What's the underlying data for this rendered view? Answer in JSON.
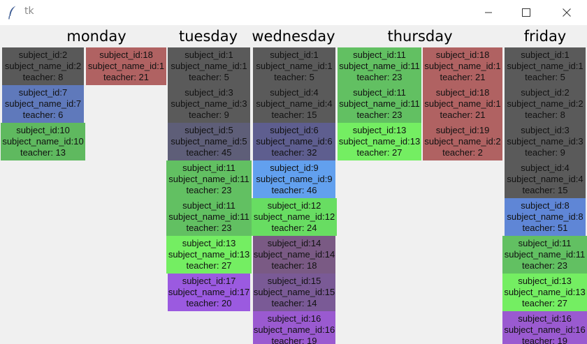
{
  "window": {
    "title": "tk",
    "icon": "feather-icon"
  },
  "days": [
    {
      "name": "monday",
      "columns": [
        [
          {
            "subject": "subject_id:2",
            "name": "subject_name_id:2",
            "teacher": "teacher: 8",
            "color": "#595959"
          },
          {
            "subject": "subject_id:7",
            "name": "subject_name_id:7",
            "teacher": "teacher: 6",
            "color": "#5f79bb"
          },
          {
            "subject": "subject_id:10",
            "name": "subject_name_id:10",
            "teacher": "teacher: 13",
            "color": "#5fb95f"
          }
        ],
        [
          {
            "subject": "subject_id:18",
            "name": "subject_name_id:1",
            "teacher": "teacher: 21",
            "color": "#b06262"
          }
        ]
      ]
    },
    {
      "name": "tuesday",
      "columns": [
        [
          {
            "subject": "subject_id:1",
            "name": "subject_name_id:1",
            "teacher": "teacher: 5",
            "color": "#5a5a5a"
          },
          {
            "subject": "subject_id:3",
            "name": "subject_name_id:3",
            "teacher": "teacher: 9",
            "color": "#5a5a5a"
          },
          {
            "subject": "subject_id:5",
            "name": "subject_name_id:5",
            "teacher": "teacher: 45",
            "color": "#5e5e78"
          },
          {
            "subject": "subject_id:11",
            "name": "subject_name_id:11",
            "teacher": "teacher: 23",
            "color": "#62c062"
          },
          {
            "subject": "subject_id:11",
            "name": "subject_name_id:11",
            "teacher": "teacher: 23",
            "color": "#62c062"
          },
          {
            "subject": "subject_id:13",
            "name": "subject_name_id:13",
            "teacher": "teacher: 27",
            "color": "#74ee62"
          },
          {
            "subject": "subject_id:17",
            "name": "subject_name_id:17",
            "teacher": "teacher: 20",
            "color": "#9b5ae0"
          }
        ]
      ]
    },
    {
      "name": "wednesday",
      "columns": [
        [
          {
            "subject": "subject_id:1",
            "name": "subject_name_id:1",
            "teacher": "teacher: 5",
            "color": "#5a5a5a"
          },
          {
            "subject": "subject_id:4",
            "name": "subject_name_id:4",
            "teacher": "teacher: 15",
            "color": "#5a5a5a"
          },
          {
            "subject": "subject_id:6",
            "name": "subject_name_id:6",
            "teacher": "teacher: 32",
            "color": "#5e5e8f"
          },
          {
            "subject": "subject_id:9",
            "name": "subject_name_id:9",
            "teacher": "teacher: 46",
            "color": "#62a0ee"
          },
          {
            "subject": "subject_id:12",
            "name": "subject_name_id:12",
            "teacher": "teacher: 24",
            "color": "#68dd62"
          },
          {
            "subject": "subject_id:14",
            "name": "subject_name_id:14",
            "teacher": "teacher: 18",
            "color": "#7a5a84"
          },
          {
            "subject": "subject_id:15",
            "name": "subject_name_id:15",
            "teacher": "teacher: 14",
            "color": "#7a5a96"
          },
          {
            "subject": "subject_id:16",
            "name": "subject_name_id:16",
            "teacher": "teacher: 19",
            "color": "#9a5ad0"
          }
        ]
      ]
    },
    {
      "name": "thursday",
      "columns": [
        [
          {
            "subject": "subject_id:11",
            "name": "subject_name_id:11",
            "teacher": "teacher: 23",
            "color": "#62c062"
          },
          {
            "subject": "subject_id:11",
            "name": "subject_name_id:11",
            "teacher": "teacher: 23",
            "color": "#62c062"
          },
          {
            "subject": "subject_id:13",
            "name": "subject_name_id:13",
            "teacher": "teacher: 27",
            "color": "#74ee62"
          }
        ],
        [
          {
            "subject": "subject_id:18",
            "name": "subject_name_id:1",
            "teacher": "teacher: 21",
            "color": "#b06262"
          },
          {
            "subject": "subject_id:18",
            "name": "subject_name_id:1",
            "teacher": "teacher: 21",
            "color": "#b06262"
          },
          {
            "subject": "subject_id:19",
            "name": "subject_name_id:2",
            "teacher": "teacher: 2",
            "color": "#b06262"
          }
        ]
      ]
    },
    {
      "name": "friday",
      "columns": [
        [
          {
            "subject": "subject_id:1",
            "name": "subject_name_id:1",
            "teacher": "teacher: 5",
            "color": "#5a5a5a"
          },
          {
            "subject": "subject_id:2",
            "name": "subject_name_id:2",
            "teacher": "teacher: 8",
            "color": "#5a5a5a"
          },
          {
            "subject": "subject_id:3",
            "name": "subject_name_id:3",
            "teacher": "teacher: 9",
            "color": "#5a5a5a"
          },
          {
            "subject": "subject_id:4",
            "name": "subject_name_id:4",
            "teacher": "teacher: 15",
            "color": "#5a5a5a"
          },
          {
            "subject": "subject_id:8",
            "name": "subject_name_id:8",
            "teacher": "teacher: 51",
            "color": "#5f86d6"
          },
          {
            "subject": "subject_id:11",
            "name": "subject_name_id:11",
            "teacher": "teacher: 23",
            "color": "#62c062"
          },
          {
            "subject": "subject_id:13",
            "name": "subject_name_id:13",
            "teacher": "teacher: 27",
            "color": "#74ee62"
          },
          {
            "subject": "subject_id:16",
            "name": "subject_name_id:16",
            "teacher": "teacher: 19",
            "color": "#9a5ad0"
          }
        ]
      ]
    }
  ]
}
